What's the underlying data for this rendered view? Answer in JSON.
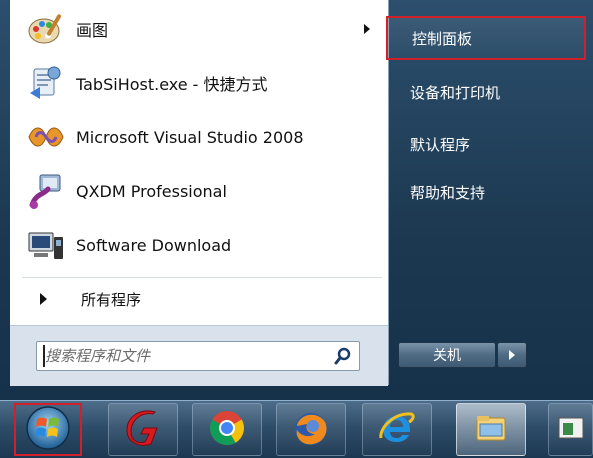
{
  "start_menu": {
    "programs": [
      {
        "label": "画图",
        "icon": "paint-icon",
        "has_submenu": true
      },
      {
        "label": "TabSiHost.exe - 快捷方式",
        "icon": "tabsihost-icon",
        "has_submenu": false
      },
      {
        "label": "Microsoft Visual Studio 2008",
        "icon": "visual-studio-icon",
        "has_submenu": false
      },
      {
        "label": "QXDM Professional",
        "icon": "qxdm-icon",
        "has_submenu": false
      },
      {
        "label": "Software Download",
        "icon": "software-download-icon",
        "has_submenu": false
      }
    ],
    "all_programs_label": "所有程序",
    "search": {
      "placeholder": "搜索程序和文件"
    },
    "right_items": [
      {
        "label": "控制面板",
        "highlighted": true
      },
      {
        "label": "设备和打印机",
        "highlighted": false
      },
      {
        "label": "默认程序",
        "highlighted": false
      },
      {
        "label": "帮助和支持",
        "highlighted": false
      }
    ],
    "shutdown_label": "关机"
  },
  "taskbar": {
    "start_button": {
      "icon": "windows-logo-icon",
      "highlighted": true
    },
    "pinned": [
      {
        "icon": "red-app-icon",
        "active": false
      },
      {
        "icon": "chrome-icon",
        "active": false
      },
      {
        "icon": "firefox-icon",
        "active": false
      },
      {
        "icon": "internet-explorer-icon",
        "active": false
      },
      {
        "icon": "file-explorer-icon",
        "active": true
      },
      {
        "icon": "window-app-icon",
        "active": false
      }
    ]
  },
  "colors": {
    "highlight_border": "#d0202a",
    "frame": "#1c3850",
    "pane": "#ffffff"
  }
}
